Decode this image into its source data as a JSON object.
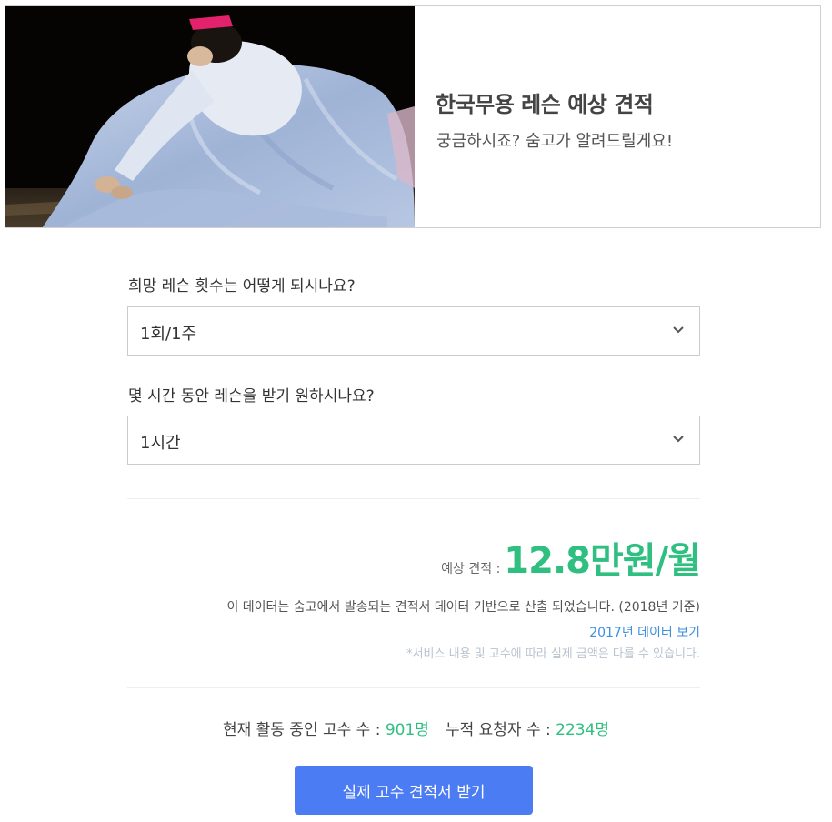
{
  "hero": {
    "title": "한국무용 레슨 예상 견적",
    "subtitle": "궁금하시죠? 숨고가 알려드릴게요!"
  },
  "questions": [
    {
      "label": "희망 레슨 횟수는 어떻게 되시나요?",
      "selected": "1회/1주"
    },
    {
      "label": "몇 시간 동안 레슨을 받기 원하시나요?",
      "selected": "1시간"
    }
  ],
  "estimate": {
    "label": "예상 견적 :",
    "value": "12.8만원/월"
  },
  "notes": {
    "source": "이 데이터는 숨고에서 발송되는 견적서 데이터 기반으로 산출 되었습니다. (2018년 기준)",
    "link": "2017년 데이터 보기",
    "disclaimer": "*서비스 내용 및 고수에 따라 실제 금액은 다를 수 있습니다."
  },
  "stats": {
    "active_label": "현재 활동 중인 고수 수 :",
    "active_value": "901명",
    "requests_label": "누적 요청자 수 :",
    "requests_value": "2234명"
  },
  "cta": {
    "label": "실제 고수 견적서 받기"
  },
  "colors": {
    "accent_green": "#2fc081",
    "link_blue": "#3d8fe0",
    "button_blue": "#4c7cf3"
  },
  "icons": {
    "select_arrow": "chevron-down-icon"
  }
}
